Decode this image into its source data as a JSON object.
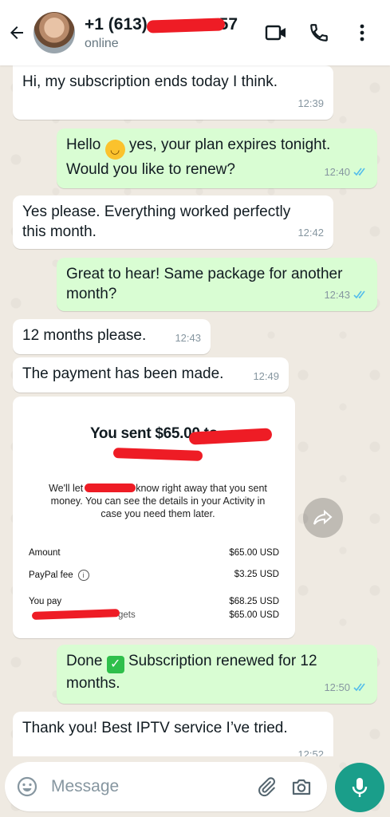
{
  "header": {
    "contact_name": "+1 (613) ",
    "contact_name_tail": "57",
    "status": "online"
  },
  "messages": {
    "m1": {
      "text": "Hi, my subscription ends today I think.",
      "time": "12:39"
    },
    "m2": {
      "text_a": "Hello ",
      "text_b": " yes, your plan expires tonight.",
      "text_c": "Would you like to renew?",
      "time": "12:40"
    },
    "m3": {
      "text_a": "Yes please. Everything worked perfectly",
      "text_b": "this month.",
      "time": "12:42"
    },
    "m4": {
      "text_a": "Great to hear! Same package for another",
      "text_b": "month?",
      "time": "12:43"
    },
    "m5": {
      "text": "12 months please.",
      "time": "12:43"
    },
    "m6": {
      "text": "The payment has been made.",
      "time": "12:49"
    },
    "m7": {
      "text_a": "Done ",
      "text_b": " Subscription renewed for 12",
      "text_c": "months.",
      "time": "12:50"
    },
    "m8": {
      "text": "Thank you! Best IPTV service I’ve tried.",
      "time": "12:52"
    }
  },
  "payment": {
    "title_prefix": "You sent ",
    "amount": "$65.00",
    "title_suffix": " to ",
    "body_a": "We'll let",
    "body_b": "know right away that you sent",
    "body_c": "money. You can see the details in your Activity in",
    "body_d": "case you need them later.",
    "rows": {
      "amount_label": "Amount",
      "amount_value": "$65.00 USD",
      "fee_label": "PayPal fee",
      "fee_value": "$3.25 USD",
      "you_pay_label": "You pay",
      "you_pay_value": "$68.25 USD",
      "gets_label": "gets",
      "gets_value": "$65.00 USD"
    }
  },
  "composer": {
    "placeholder": "Message"
  },
  "colors": {
    "header_bg": "#ffffff",
    "chat_bg": "#efeae2",
    "incoming": "#ffffff",
    "outgoing": "#d9fdd3",
    "read_ticks": "#53bdeb",
    "accent": "#1a9e8a",
    "redaction": "#ee1c25"
  },
  "icons": [
    "back-arrow-icon",
    "video-call-icon",
    "phone-icon",
    "more-vert-icon",
    "forward-icon",
    "emoji-icon",
    "attach-icon",
    "camera-icon",
    "mic-icon",
    "read-ticks-icon"
  ]
}
